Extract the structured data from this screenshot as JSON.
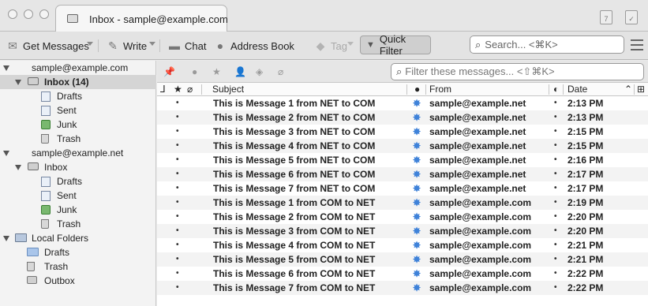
{
  "window": {
    "tab_title": "Inbox - sample@example.com"
  },
  "toolbar": {
    "get_messages": "Get Messages",
    "write": "Write",
    "chat": "Chat",
    "address_book": "Address Book",
    "tag": "Tag",
    "quick_filter": "Quick Filter",
    "search_placeholder": "Search... <⌘K>"
  },
  "folders": [
    {
      "label": "sample@example.com",
      "type": "account",
      "level": 0,
      "expanded": true
    },
    {
      "label": "Inbox (14)",
      "type": "inbox",
      "level": 1,
      "expanded": true,
      "selected": true,
      "bold": true
    },
    {
      "label": "Drafts",
      "type": "drafts",
      "level": 2
    },
    {
      "label": "Sent",
      "type": "sent",
      "level": 2
    },
    {
      "label": "Junk",
      "type": "junk",
      "level": 2
    },
    {
      "label": "Trash",
      "type": "trash",
      "level": 2
    },
    {
      "label": "sample@example.net",
      "type": "account",
      "level": 0,
      "expanded": true
    },
    {
      "label": "Inbox",
      "type": "inbox",
      "level": 1,
      "expanded": true
    },
    {
      "label": "Drafts",
      "type": "drafts",
      "level": 2
    },
    {
      "label": "Sent",
      "type": "sent",
      "level": 2
    },
    {
      "label": "Junk",
      "type": "junk",
      "level": 2
    },
    {
      "label": "Trash",
      "type": "trash",
      "level": 2
    },
    {
      "label": "Local Folders",
      "type": "local",
      "level": 0,
      "expanded": true
    },
    {
      "label": "Drafts",
      "type": "folder",
      "level": 1
    },
    {
      "label": "Trash",
      "type": "trash",
      "level": 1
    },
    {
      "label": "Outbox",
      "type": "outbox",
      "level": 1
    }
  ],
  "filter_bar": {
    "placeholder": "Filter these messages... <⇧⌘K>"
  },
  "columns": {
    "subject": "Subject",
    "from": "From",
    "date": "Date"
  },
  "messages": [
    {
      "subject": "This is Message 1 from NET to COM",
      "from": "sample@example.net",
      "date": "2:13 PM"
    },
    {
      "subject": "This is Message 2 from NET to COM",
      "from": "sample@example.net",
      "date": "2:13 PM"
    },
    {
      "subject": "This is Message 3 from NET to COM",
      "from": "sample@example.net",
      "date": "2:15 PM"
    },
    {
      "subject": "This is Message 4 from NET to COM",
      "from": "sample@example.net",
      "date": "2:15 PM"
    },
    {
      "subject": "This is Message 5 from NET to COM",
      "from": "sample@example.net",
      "date": "2:16 PM"
    },
    {
      "subject": "This is Message 6 from NET to COM",
      "from": "sample@example.net",
      "date": "2:17 PM"
    },
    {
      "subject": "This is Message 7 from NET to COM",
      "from": "sample@example.net",
      "date": "2:17 PM"
    },
    {
      "subject": "This is Message 1 from COM to NET",
      "from": "sample@example.com",
      "date": "2:19 PM"
    },
    {
      "subject": "This is Message 2 from COM to NET",
      "from": "sample@example.com",
      "date": "2:20 PM"
    },
    {
      "subject": "This is Message 3 from COM to NET",
      "from": "sample@example.com",
      "date": "2:20 PM"
    },
    {
      "subject": "This is Message 4 from COM to NET",
      "from": "sample@example.com",
      "date": "2:21 PM"
    },
    {
      "subject": "This is Message 5 from COM to NET",
      "from": "sample@example.com",
      "date": "2:21 PM"
    },
    {
      "subject": "This is Message 6 from COM to NET",
      "from": "sample@example.com",
      "date": "2:22 PM"
    },
    {
      "subject": "This is Message 7 from COM to NET",
      "from": "sample@example.com",
      "date": "2:22 PM"
    }
  ]
}
